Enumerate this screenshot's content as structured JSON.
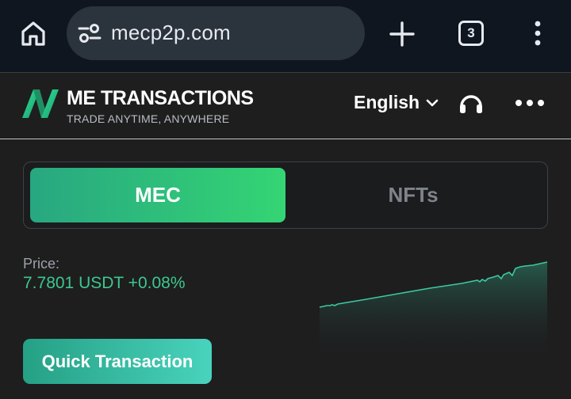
{
  "browser": {
    "url": "mecp2p.com",
    "tab_count": "3",
    "icons": [
      "home-icon",
      "site-settings-icon",
      "new-tab-icon",
      "tab-switcher-icon",
      "overflow-menu-icon"
    ]
  },
  "header": {
    "brand_name": "ME TRANSACTIONS",
    "tagline": "TRADE ANYTIME, ANYWHERE",
    "language": "English",
    "icons": [
      "logo-icon",
      "chevron-down-icon",
      "headset-icon",
      "more-icon"
    ]
  },
  "tabs": [
    {
      "label": "MEC",
      "active": true
    },
    {
      "label": "NFTs",
      "active": false
    }
  ],
  "price": {
    "label": "Price:",
    "value": "7.7801 USDT +0.08%"
  },
  "cta": {
    "label": "Quick Transaction"
  },
  "colors": {
    "accent_green": "#3cc88f",
    "tab_gradient_start": "#28a781",
    "tab_gradient_end": "#34d574",
    "cta_gradient_start": "#25a085",
    "cta_gradient_end": "#49d3bd",
    "background": "#1e1e1f",
    "browser_bar": "#0f1620"
  }
}
